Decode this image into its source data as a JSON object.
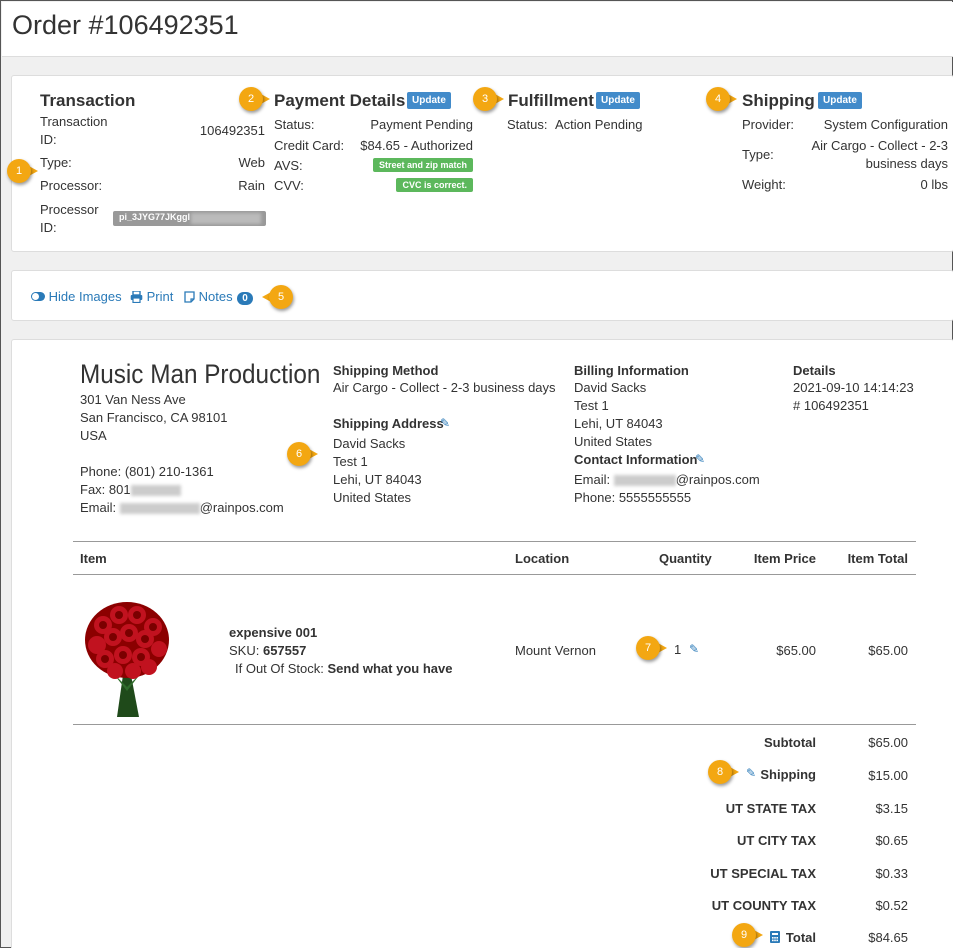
{
  "page_title": "Order #106492351",
  "transaction": {
    "title": "Transaction",
    "id_label_1": "Transaction",
    "id_label_2": "ID:",
    "id_value": "106492351",
    "type_label": "Type:",
    "type_value": "Web",
    "processor_label": "Processor:",
    "processor_value": "Rain",
    "processor_id_label_1": "Processor",
    "processor_id_label_2": "ID:",
    "processor_id_value": "pi_3JYG77JKggI"
  },
  "payment": {
    "title": "Payment Details",
    "update": "Update",
    "status_label": "Status:",
    "status_value": "Payment Pending",
    "card_label": "Credit Card:",
    "card_value": "$84.65 - Authorized",
    "avs_label": "AVS:",
    "avs_value": "Street and zip match",
    "cvv_label": "CVV:",
    "cvv_value": "CVC is correct."
  },
  "fulfillment": {
    "title": "Fulfillment",
    "update": "Update",
    "status_label": "Status:",
    "status_value": "Action Pending"
  },
  "shipping_panel": {
    "title": "Shipping",
    "update": "Update",
    "provider_label": "Provider:",
    "provider_value": "System Configuration",
    "type_label": "Type:",
    "type_value_1": "Air Cargo - Collect - 2-3",
    "type_value_2": "business days",
    "weight_label": "Weight:",
    "weight_value": "0 lbs"
  },
  "toolbar": {
    "hide_images": "Hide Images",
    "print": "Print",
    "notes": "Notes",
    "notes_count": "0"
  },
  "store": {
    "name": "Music Man Production",
    "address1": "301 Van Ness Ave",
    "address2": "San Francisco, CA 98101",
    "country": "USA",
    "phone": "Phone: (801) 210-1361",
    "fax_prefix": "Fax: 801",
    "email_suffix": "@rainpos.com",
    "email_label": "Email: "
  },
  "shipping_method": {
    "label": "Shipping Method",
    "value": "Air Cargo - Collect - 2-3 business days"
  },
  "shipping_address": {
    "label": "Shipping Address",
    "name": "David Sacks",
    "line1": "Test 1",
    "city": "Lehi, UT 84043",
    "country": "United States"
  },
  "billing": {
    "label": "Billing Information",
    "name": "David Sacks",
    "line1": "Test 1",
    "city": "Lehi, UT 84043",
    "country": "United States"
  },
  "contact": {
    "label": "Contact Information",
    "email_label": "Email: ",
    "email_suffix": "@rainpos.com",
    "phone": "Phone: 5555555555"
  },
  "details": {
    "label": "Details",
    "date": "2021-09-10 14:14:23",
    "order": "# 106492351"
  },
  "items_table": {
    "headers": [
      "Item",
      "Location",
      "Quantity",
      "Item Price",
      "Item Total"
    ],
    "rows": [
      {
        "name": "expensive 001",
        "sku_label": "SKU: ",
        "sku": "657557",
        "oos_label": "If Out Of Stock: ",
        "oos_value": "Send what you have",
        "location": "Mount Vernon",
        "quantity": "1",
        "price": "$65.00",
        "total": "$65.00"
      }
    ]
  },
  "totals": [
    {
      "label": "Subtotal",
      "value": "$65.00"
    },
    {
      "label": "Shipping",
      "value": "$15.00"
    },
    {
      "label": "UT STATE TAX",
      "value": "$3.15"
    },
    {
      "label": "UT CITY TAX",
      "value": "$0.65"
    },
    {
      "label": "UT SPECIAL TAX",
      "value": "$0.33"
    },
    {
      "label": "UT COUNTY TAX",
      "value": "$0.52"
    },
    {
      "label": "Total",
      "value": "$84.65"
    }
  ],
  "callouts": [
    "1",
    "2",
    "3",
    "4",
    "5",
    "6",
    "7",
    "8",
    "9"
  ],
  "colors": {
    "callout": "#f3a712",
    "update_button": "#428bca",
    "badge_green": "#5cb85c",
    "link": "#2a7ab8"
  }
}
